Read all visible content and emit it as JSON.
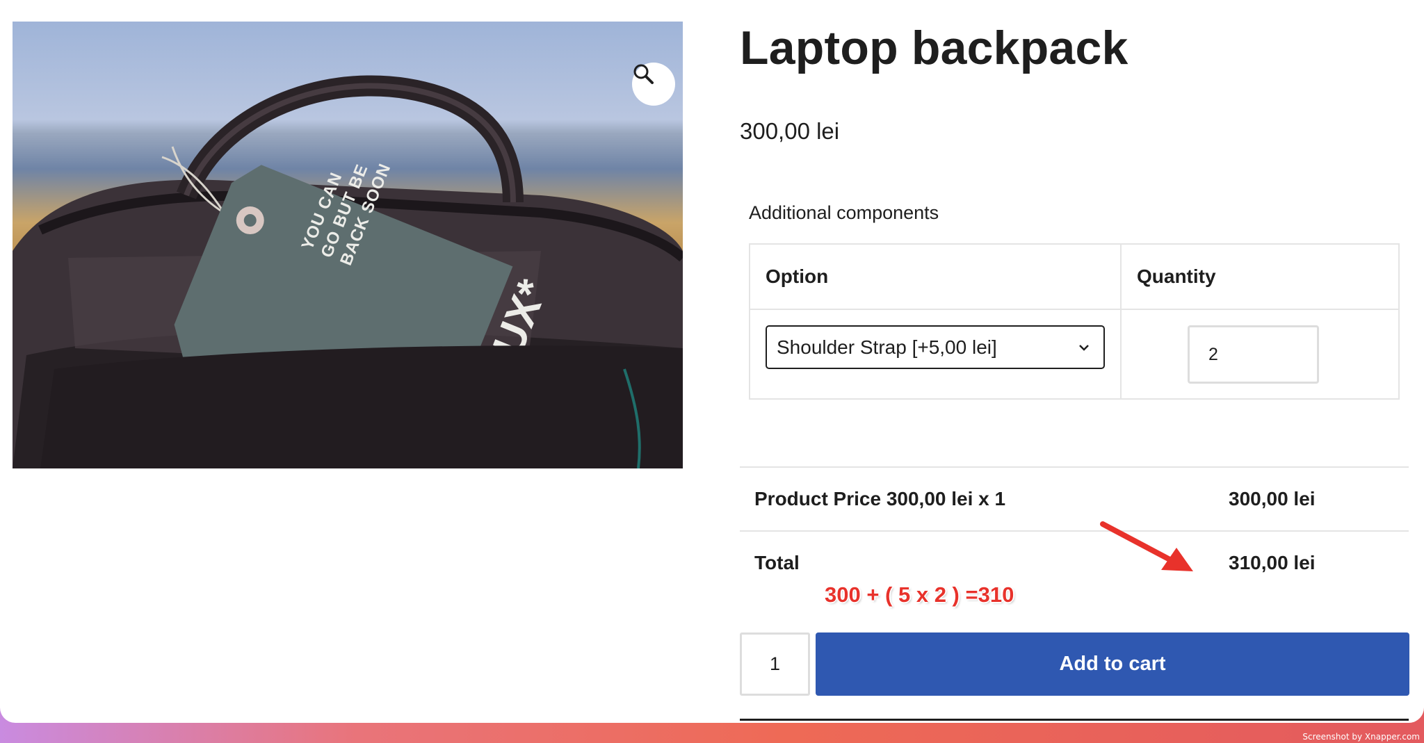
{
  "product": {
    "title": "Laptop backpack",
    "price": "300,00 lei",
    "image_tag_text": "YOU CAN GO BUT BE BACK SOON",
    "image_tag_brand": "LUX*"
  },
  "addons": {
    "heading": "Additional components",
    "columns": [
      "Option",
      "Quantity"
    ],
    "selected_option": "Shoulder Strap [+5,00 lei]",
    "option_quantity": "2"
  },
  "totals": {
    "product_price_label": "Product Price 300,00 lei x 1",
    "product_price_value": "300,00 lei",
    "total_label": "Total",
    "total_value": "310,00 lei"
  },
  "annotation": {
    "text": "300 + ( 5 x 2 ) =310",
    "color": "#e8322b"
  },
  "cart": {
    "quantity": "1",
    "add_to_cart_label": "Add to cart",
    "button_color": "#2f58b1"
  },
  "icons": {
    "zoom": "magnifier-icon",
    "select": "chevron-down-icon"
  },
  "watermark": "Screenshot by Xnapper.com"
}
